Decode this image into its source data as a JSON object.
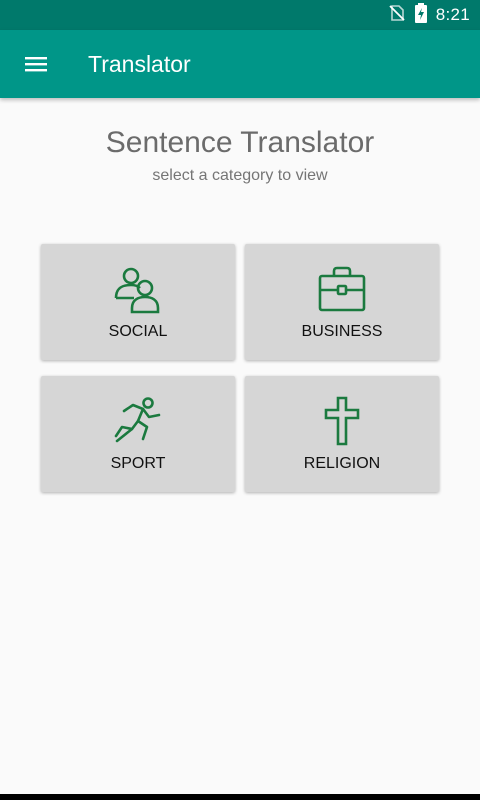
{
  "status_bar": {
    "time": "8:21",
    "icons": [
      "no-sim-icon",
      "battery-charging-icon"
    ]
  },
  "app_bar": {
    "title": "Translator",
    "menu_icon": "menu-icon"
  },
  "main": {
    "title": "Sentence Translator",
    "subtitle": "select a category to view",
    "categories": [
      {
        "label": "SOCIAL",
        "icon": "people-icon"
      },
      {
        "label": "BUSINESS",
        "icon": "briefcase-icon"
      },
      {
        "label": "SPORT",
        "icon": "runner-icon"
      },
      {
        "label": "RELIGION",
        "icon": "cross-icon"
      }
    ]
  },
  "colors": {
    "status_bar": "#00796b",
    "app_bar": "#009688",
    "icon_green": "#1b7a3f",
    "card": "#d6d6d6",
    "background": "#fafafa"
  }
}
